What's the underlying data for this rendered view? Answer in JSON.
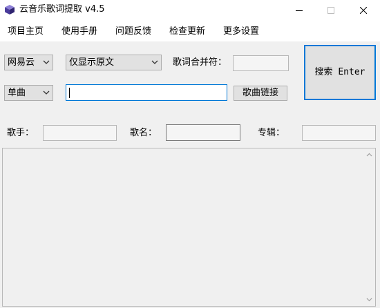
{
  "window": {
    "title": "云音乐歌词提取 v4.5"
  },
  "menu": {
    "items": [
      "项目主页",
      "使用手册",
      "问题反馈",
      "检查更新",
      "更多设置"
    ]
  },
  "controls": {
    "source_select": "网易云",
    "display_mode_select": "仅显示原文",
    "lyric_separator_label": "歌词合并符：",
    "lyric_separator_value": "",
    "type_select": "单曲",
    "search_input_value": "",
    "song_link_button": "歌曲链接",
    "search_button": "搜索 Enter"
  },
  "info": {
    "artist_label": "歌手：",
    "artist_value": "",
    "song_label": "歌名：",
    "song_value": "",
    "album_label": "专辑：",
    "album_value": ""
  },
  "output": {
    "text": ""
  },
  "colors": {
    "accent_border": "#0078d7",
    "window_bg": "#f0f0f0"
  },
  "icons": {
    "app": "cube-app-icon",
    "minimize": "minimize-icon",
    "maximize": "maximize-icon",
    "close": "close-icon",
    "dropdown": "chevron-down-icon",
    "scroll_up": "scroll-up-arrow-icon",
    "scroll_down": "scroll-down-arrow-icon"
  }
}
